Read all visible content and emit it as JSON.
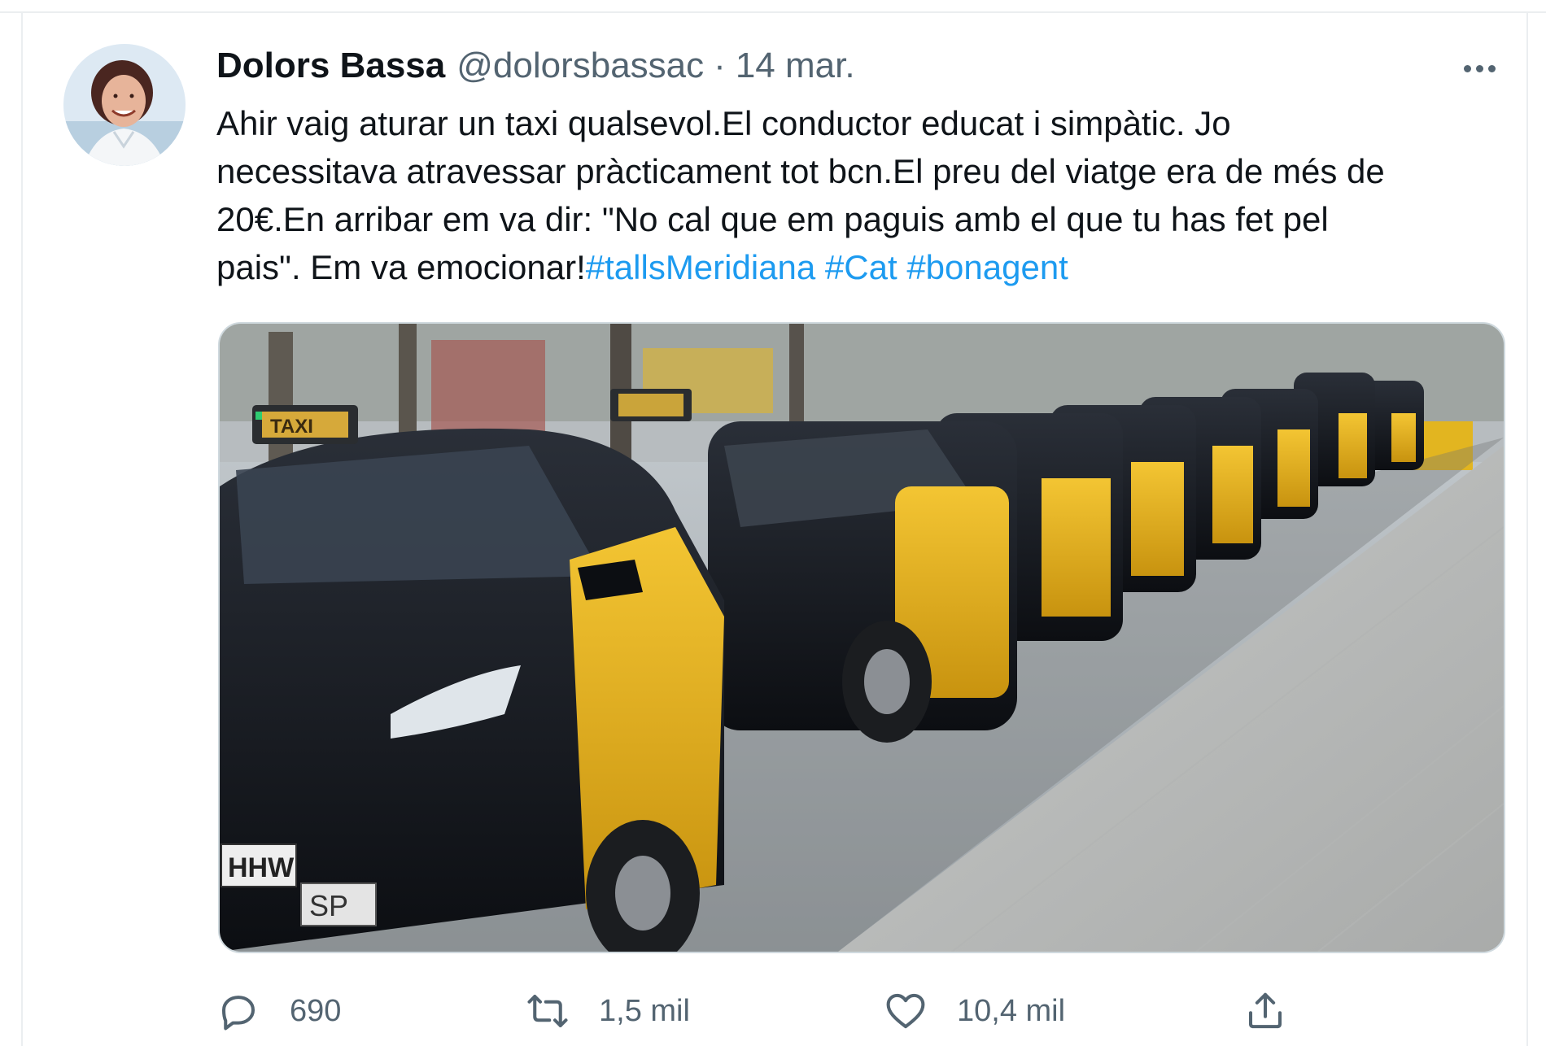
{
  "tweet": {
    "author_name": "Dolors Bassa",
    "author_handle": "@dolorsbassac",
    "separator": "·",
    "date": "14 mar.",
    "text_lines": [
      "Ahir vaig aturar un taxi qualsevol.El conductor educat i simpàtic. Jo",
      "necessitava atravessar pràcticament tot bcn.El preu del viatge era de més de",
      "20€.En arribar em va dir: \"No cal que em paguis amb el que tu has fet pel",
      "pais\". Em va emocionar!"
    ],
    "hashtags": [
      "#tallsMeridiana",
      "#Cat",
      "#bonagent"
    ],
    "media": {
      "taxi_sign_text": "TAXI",
      "plate_text": "HHW",
      "plate_badge": "SP"
    },
    "actions": {
      "reply_count": "690",
      "retweet_count": "1,5 mil",
      "like_count": "10,4 mil"
    }
  },
  "icons": {
    "reply": "reply-bubble-icon",
    "retweet": "retweet-arrows-icon",
    "like": "heart-icon",
    "share": "share-upload-icon",
    "more": "more-dots-icon"
  },
  "colors": {
    "text": "#0f1419",
    "secondary": "#536471",
    "hashtag": "#1d9bf0",
    "taxi_yellow": "#e8b422",
    "taxi_black": "#14171c"
  }
}
